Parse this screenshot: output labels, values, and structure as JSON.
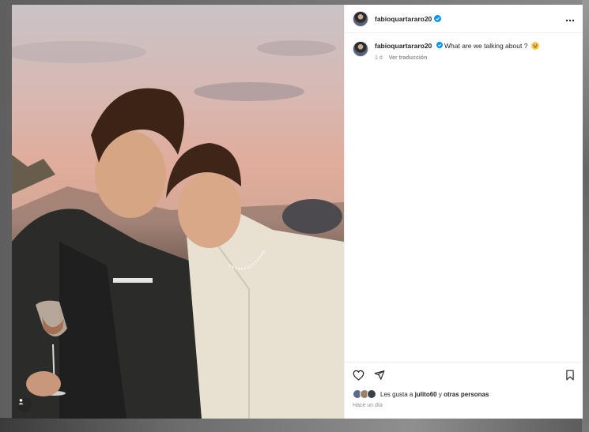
{
  "post": {
    "username": "fabioquartararo20",
    "caption": "What are we talking about ?",
    "caption_emoji": "grinning-sweat-emoji",
    "age": "1 d",
    "translate_label": "Ver traducción",
    "likes_prefix": "Les gusta a",
    "likes_user": "julito60",
    "likes_connector": "y",
    "likes_others": "otras personas",
    "time_ago": "Hace un día"
  },
  "icons": {
    "more": "more-options-icon",
    "like": "heart-icon",
    "share": "share-icon",
    "save": "bookmark-icon",
    "tag": "user-tag-icon",
    "verified": "verified-badge-icon"
  },
  "colors": {
    "verified": "#0095f6",
    "text": "#262626",
    "secondary": "#8e8e8e"
  }
}
